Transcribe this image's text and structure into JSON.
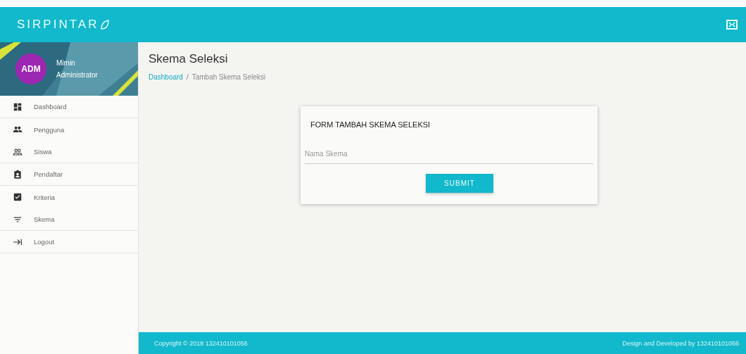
{
  "header": {
    "logo": "SIRPINTAR"
  },
  "user": {
    "avatar": "ADM",
    "name": "Mimin",
    "role": "Administrator"
  },
  "sidebar": {
    "items": [
      {
        "label": "Dashboard",
        "divider": true
      },
      {
        "label": "Pengguna",
        "divider": false
      },
      {
        "label": "Siswa",
        "divider": true
      },
      {
        "label": "Pendaftar",
        "divider": true
      },
      {
        "label": "Kriteria",
        "divider": false
      },
      {
        "label": "Skema",
        "divider": true
      },
      {
        "label": "Logout",
        "divider": true
      }
    ]
  },
  "page": {
    "title": "Skema Seleksi",
    "breadcrumb": [
      "Dashboard",
      "Tambah Skema Seleksi"
    ],
    "breadcrumb_separator": "/"
  },
  "form": {
    "title": "FORM TAMBAH SKEMA SELEKSI",
    "field": {
      "placeholder": "Nama Skema"
    },
    "button": "SUBMIT"
  },
  "footer": {
    "left": "Copyright © 2018 132410101056",
    "right": "Design and Developed by 132410101056"
  }
}
